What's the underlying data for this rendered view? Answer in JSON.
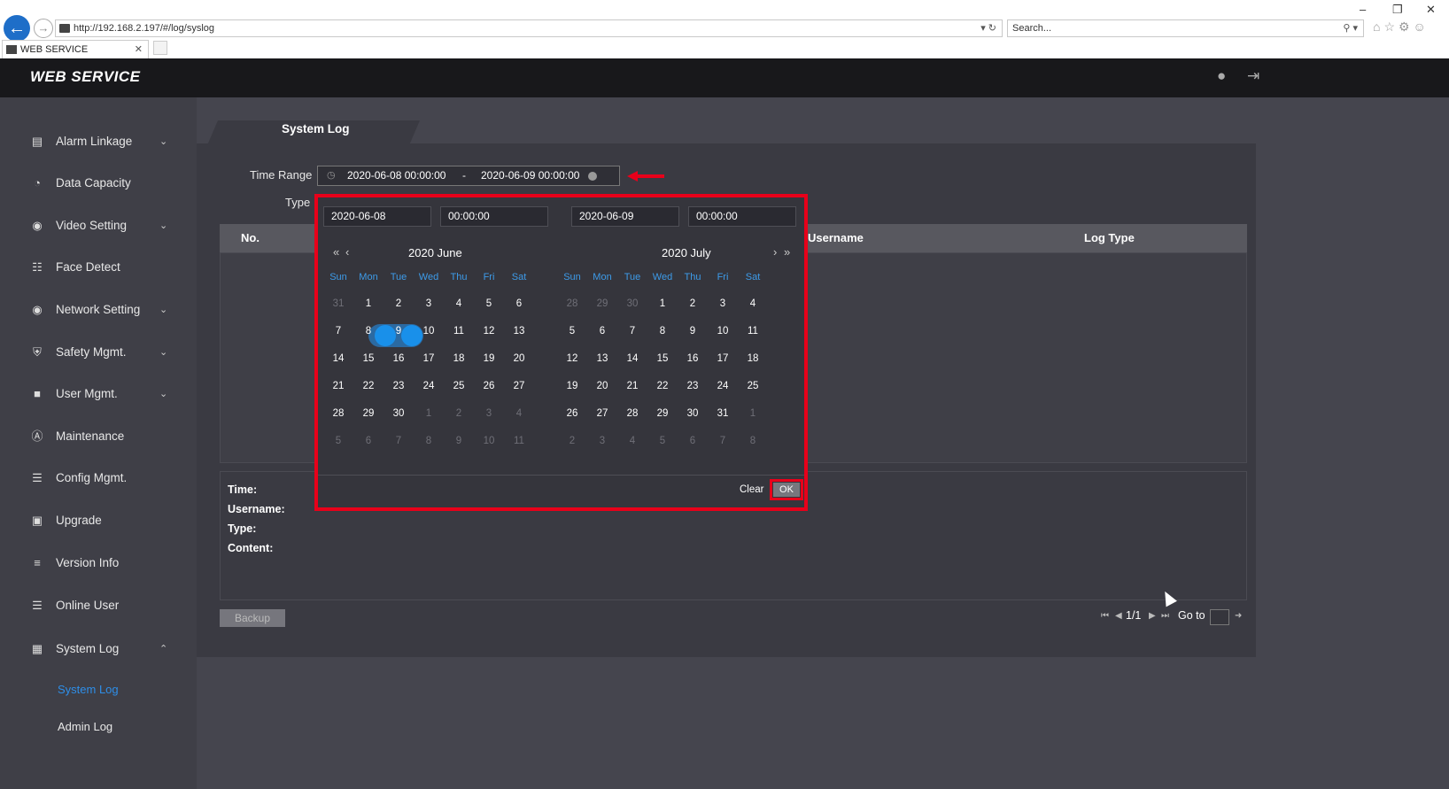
{
  "browser": {
    "url": "http://192.168.2.197/#/log/syslog",
    "search_placeholder": "Search...",
    "tab_title": "WEB SERVICE"
  },
  "app": {
    "brand": "WEB SERVICE"
  },
  "sidebar": {
    "items": [
      {
        "label": "Alarm Linkage",
        "icon": "alarm-icon",
        "expandable": true
      },
      {
        "label": "Data Capacity",
        "icon": "pie-chart-icon",
        "expandable": false
      },
      {
        "label": "Video Setting",
        "icon": "camera-icon",
        "expandable": true
      },
      {
        "label": "Face Detect",
        "icon": "face-icon",
        "expandable": false
      },
      {
        "label": "Network Setting",
        "icon": "globe-icon",
        "expandable": true
      },
      {
        "label": "Safety Mgmt.",
        "icon": "shield-icon",
        "expandable": true
      },
      {
        "label": "User Mgmt.",
        "icon": "user-icon",
        "expandable": true
      },
      {
        "label": "Maintenance",
        "icon": "maintenance-icon",
        "expandable": false
      },
      {
        "label": "Config Mgmt.",
        "icon": "sliders-icon",
        "expandable": false
      },
      {
        "label": "Upgrade",
        "icon": "upgrade-icon",
        "expandable": false
      },
      {
        "label": "Version Info",
        "icon": "layers-icon",
        "expandable": false
      },
      {
        "label": "Online User",
        "icon": "list-user-icon",
        "expandable": false
      },
      {
        "label": "System Log",
        "icon": "log-icon",
        "expandable": true
      }
    ],
    "subitems": [
      {
        "label": "System Log",
        "active": true
      },
      {
        "label": "Admin Log",
        "active": false
      }
    ]
  },
  "main": {
    "title": "System Log",
    "time_range_label": "Time Range",
    "type_label": "Type",
    "time_range_start": "2020-06-08 00:00:00",
    "time_range_sep": "-",
    "time_range_end": "2020-06-09 00:00:00",
    "table_headers": {
      "no": "No.",
      "username": "Username",
      "log_type": "Log Type"
    },
    "detail_labels": {
      "time": "Time:",
      "username": "Username:",
      "type": "Type:",
      "content": "Content:"
    },
    "backup_label": "Backup",
    "pagination": {
      "page": "1/1",
      "goto_label": "Go to"
    }
  },
  "picker": {
    "start_date": "2020-06-08",
    "start_time": "00:00:00",
    "end_date": "2020-06-09",
    "end_time": "00:00:00",
    "weekdays": [
      "Sun",
      "Mon",
      "Tue",
      "Wed",
      "Thu",
      "Fri",
      "Sat"
    ],
    "left_month": "2020 June",
    "right_month": "2020 July",
    "left_days": [
      [
        "31",
        "1",
        "2",
        "3",
        "4",
        "5",
        "6"
      ],
      [
        "7",
        "8",
        "9",
        "10",
        "11",
        "12",
        "13"
      ],
      [
        "14",
        "15",
        "16",
        "17",
        "18",
        "19",
        "20"
      ],
      [
        "21",
        "22",
        "23",
        "24",
        "25",
        "26",
        "27"
      ],
      [
        "28",
        "29",
        "30",
        "1",
        "2",
        "3",
        "4"
      ],
      [
        "5",
        "6",
        "7",
        "8",
        "9",
        "10",
        "11"
      ]
    ],
    "right_days": [
      [
        "28",
        "29",
        "30",
        "1",
        "2",
        "3",
        "4"
      ],
      [
        "5",
        "6",
        "7",
        "8",
        "9",
        "10",
        "11"
      ],
      [
        "12",
        "13",
        "14",
        "15",
        "16",
        "17",
        "18"
      ],
      [
        "19",
        "20",
        "21",
        "22",
        "23",
        "24",
        "25"
      ],
      [
        "26",
        "27",
        "28",
        "29",
        "30",
        "31",
        "1"
      ],
      [
        "2",
        "3",
        "4",
        "5",
        "6",
        "7",
        "8"
      ]
    ],
    "clear_label": "Clear",
    "ok_label": "OK",
    "highlight_color": "#e8001a",
    "accent_color": "#1990ea"
  }
}
